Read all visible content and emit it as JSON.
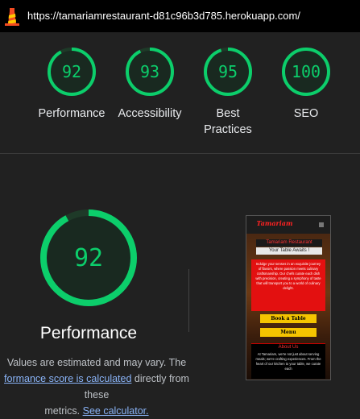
{
  "url_bar": {
    "url": "https://tamariamrestaurant-d81c96b3d785.herokuapp.com/",
    "logo_icon": "lighthouse-icon"
  },
  "summary": {
    "categories": [
      {
        "score": "92",
        "label": "Performance"
      },
      {
        "score": "93",
        "label": "Accessibility"
      },
      {
        "score": "95",
        "label": "Best Practices"
      },
      {
        "score": "100",
        "label": "SEO"
      }
    ]
  },
  "performance": {
    "score": "92",
    "title": "Performance",
    "note_prefix": "Values are estimated and may vary. The",
    "note_link": "formance score is calculated",
    "note_mid": " directly from these",
    "note_end": "metrics. ",
    "note_link2": "See calculator."
  },
  "screenshot": {
    "brand": "Tamariam",
    "title": "Tamariam Restaurant",
    "subtitle": "Your Table Awaits !",
    "intro": "Indulge your senses in an exquisite journey of flavors, where passion meets culinary craftsmanship. Our chefs curate each dish with precision, creating a symphony of taste that will transport you to a world of culinary delight.",
    "book_button": "Book a Table",
    "menu_button": "Menu",
    "about_title": "About Us",
    "about_text": "At Tamariam, we're not just about serving meals; we're crafting experiences. From the heart of our kitchen to your table, we curate each"
  },
  "colors": {
    "pass_green": "#0cce6b",
    "background": "#212121",
    "link": "#8ab4f8"
  }
}
